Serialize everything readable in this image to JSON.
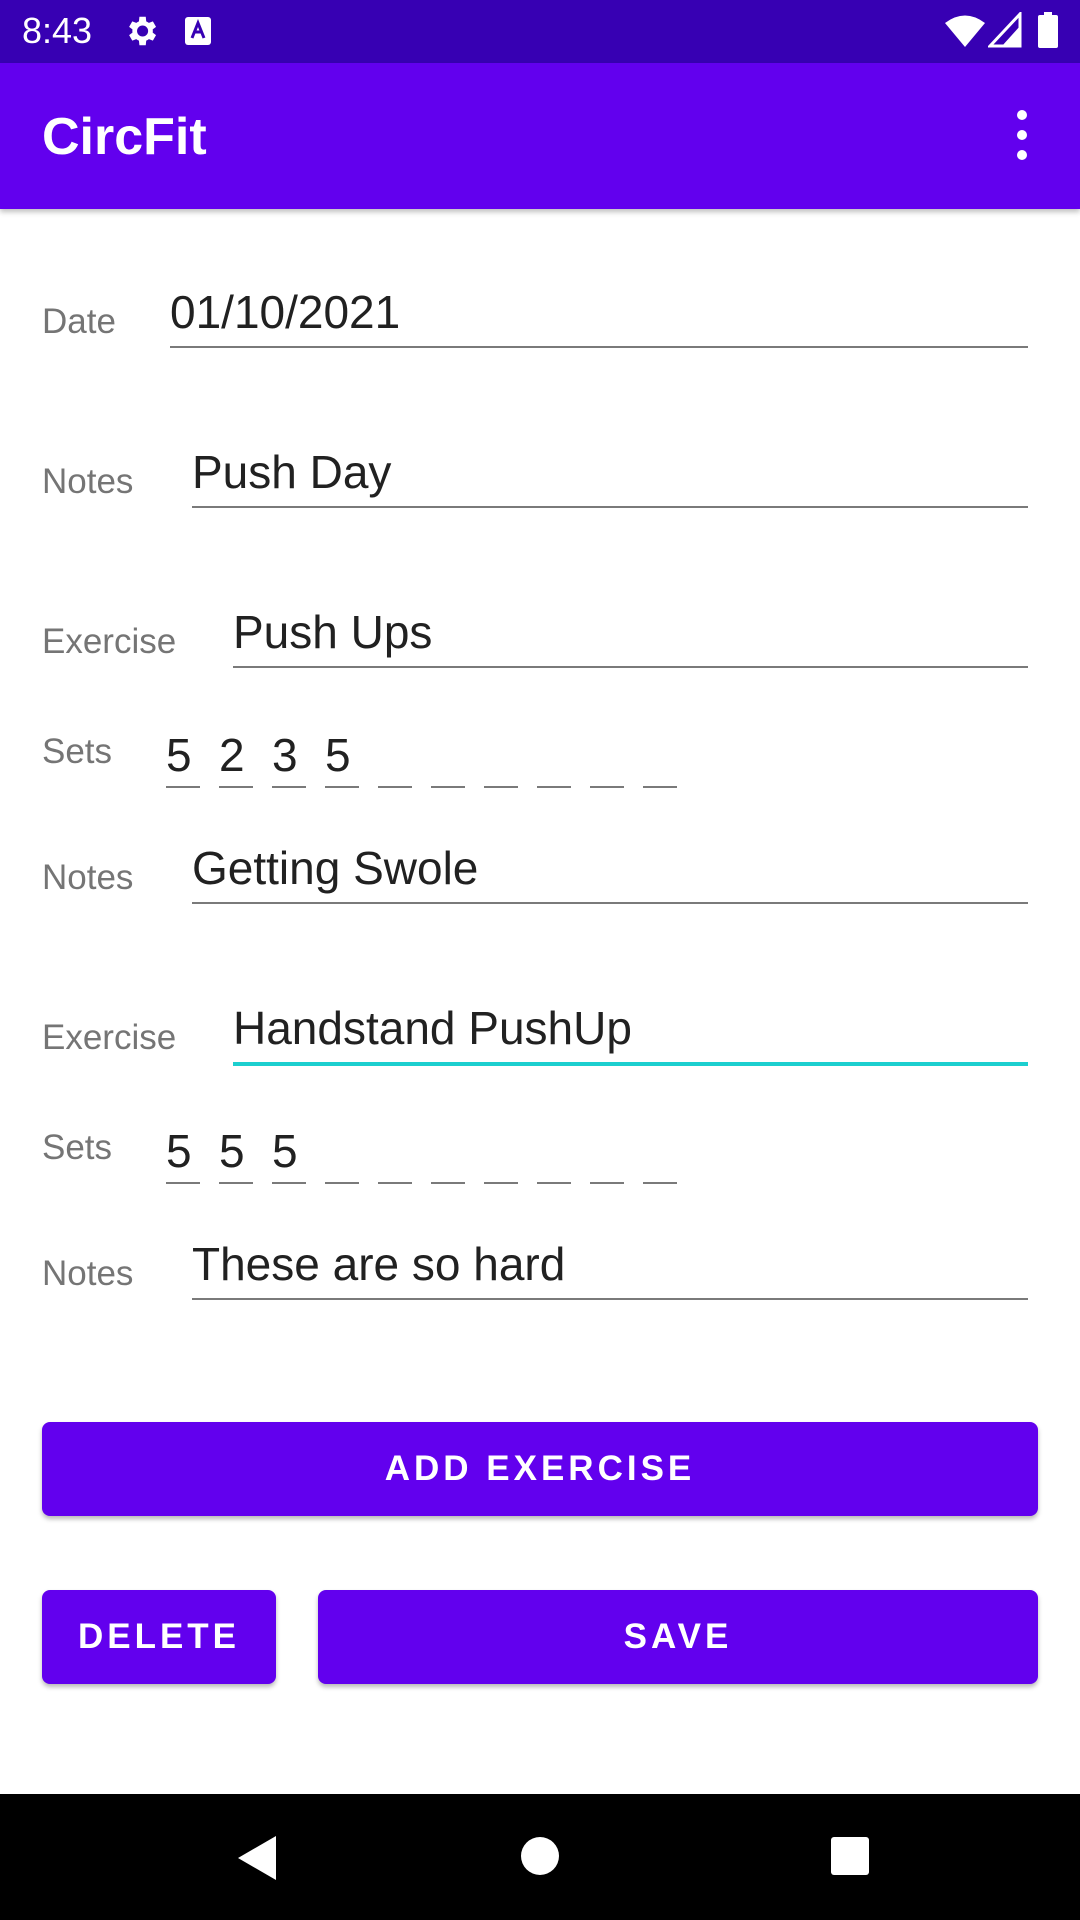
{
  "status_bar": {
    "time": "8:43",
    "icons": [
      "gear-icon",
      "a-icon",
      "wifi-icon",
      "signal-icon",
      "battery-icon"
    ]
  },
  "app_bar": {
    "title": "CircFit",
    "menu_icon": "more-vert-icon"
  },
  "workout": {
    "date_label": "Date",
    "date_value": "01/10/2021",
    "notes_label": "Notes",
    "notes_value": "Push Day"
  },
  "exercises": [
    {
      "exercise_label": "Exercise",
      "name": "Push Ups",
      "sets_label": "Sets",
      "sets": [
        "5",
        "2",
        "3",
        "5",
        "",
        "",
        "",
        "",
        "",
        ""
      ],
      "notes_label": "Notes",
      "notes": "Getting Swole"
    },
    {
      "exercise_label": "Exercise",
      "name": "Handstand PushUp",
      "sets_label": "Sets",
      "sets": [
        "5",
        "5",
        "5",
        "",
        "",
        "",
        "",
        "",
        "",
        ""
      ],
      "notes_label": "Notes",
      "notes": "These are so hard"
    }
  ],
  "buttons": {
    "add_exercise": "ADD EXERCISE",
    "delete": "DELETE",
    "save": "SAVE"
  },
  "colors": {
    "status_bar": "#3700b3",
    "primary": "#6200ee",
    "focus_underline": "#1ccfcf"
  },
  "nav_bar": {
    "icons": [
      "back-icon",
      "home-icon",
      "recents-icon"
    ]
  }
}
